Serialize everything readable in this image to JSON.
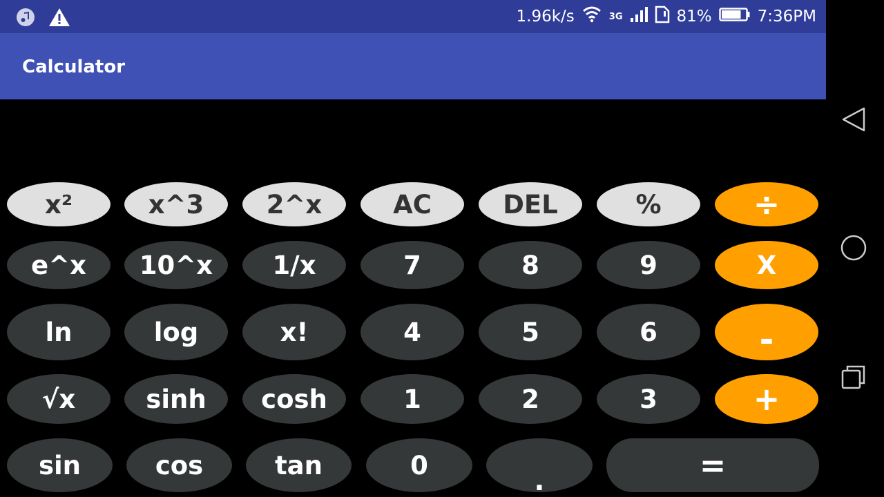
{
  "status_bar": {
    "net_speed": "1.96k/s",
    "network_type": "3G",
    "battery_percent": "81%",
    "battery_level": 0.81,
    "time": "7:36PM",
    "icons": [
      "music-icon",
      "warning-icon",
      "wifi-icon",
      "signal-icon",
      "sim-icon",
      "battery-icon"
    ]
  },
  "app_bar": {
    "title": "Calculator"
  },
  "display": {
    "value": ""
  },
  "keypad": {
    "rows": [
      [
        "x²",
        "x^3",
        "2^x",
        "AC",
        "DEL",
        "%",
        "÷"
      ],
      [
        "e^x",
        "10^x",
        "1/x",
        "7",
        "8",
        "9",
        "X"
      ],
      [
        "ln",
        "log",
        "x!",
        "4",
        "5",
        "6",
        "-"
      ],
      [
        "√x",
        "sinh",
        "cosh",
        "1",
        "2",
        "3",
        "+"
      ],
      [
        "sin",
        "cos",
        "tan",
        "0",
        ".",
        "="
      ]
    ]
  },
  "nav_bar": {
    "buttons": [
      "back-icon",
      "home-icon",
      "recents-icon"
    ]
  },
  "colors": {
    "status_bar": "#2f3d98",
    "app_bar": "#3f51b5",
    "key_light": "#e0e0e0",
    "key_dark": "#343838",
    "key_operator": "#ff9f00",
    "background": "#000000"
  }
}
